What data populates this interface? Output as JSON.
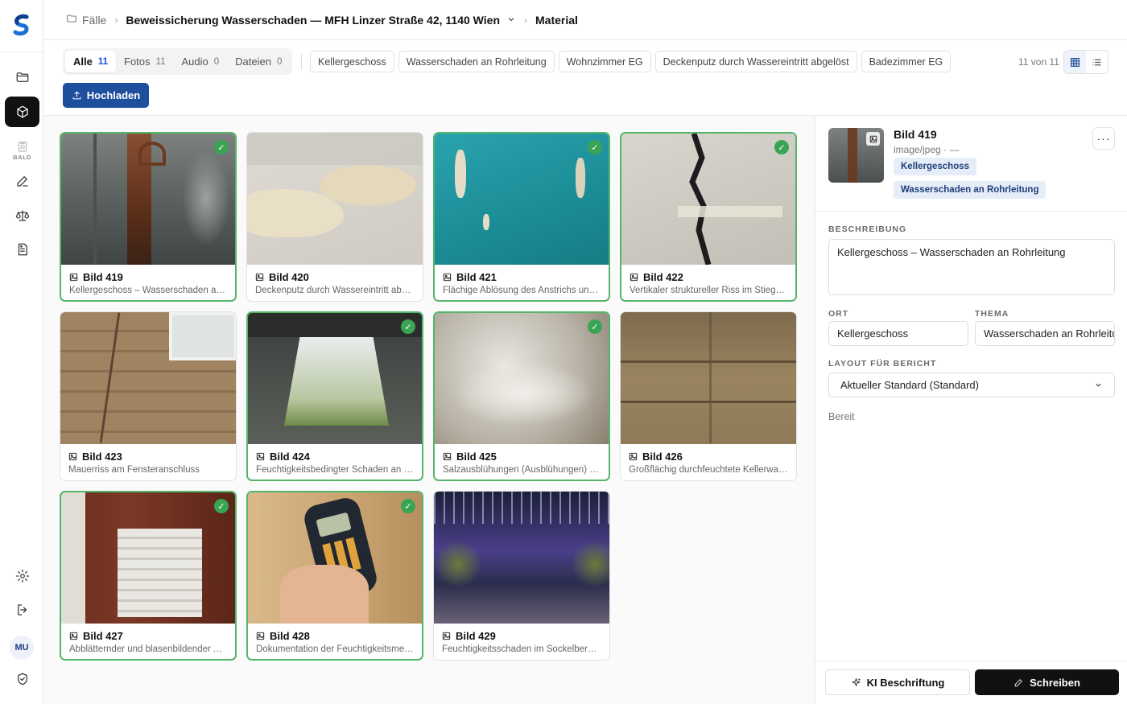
{
  "brand": {
    "accent": "#1e4f9c",
    "selected_border": "#55b56a",
    "check": "#3aa455"
  },
  "rail": {
    "soon_label": "BALD",
    "avatar": "MU"
  },
  "breadcrumb": {
    "root": "Fälle",
    "case": "Beweissicherung Wasserschaden — MFH Linzer Straße 42, 1140 Wien",
    "current": "Material"
  },
  "tabs": [
    {
      "label": "Alle",
      "count": "11"
    },
    {
      "label": "Fotos",
      "count": "11"
    },
    {
      "label": "Audio",
      "count": "0"
    },
    {
      "label": "Dateien",
      "count": "0"
    }
  ],
  "filters": [
    "Kellergeschoss",
    "Wasserschaden an Rohrleitung",
    "Wohnzimmer EG",
    "Deckenputz durch Wassereintritt abgelöst",
    "Badezimmer EG"
  ],
  "result_count": "11 von 11",
  "upload_label": "Hochladen",
  "items": [
    {
      "title": "Bild 419",
      "desc": "Kellergeschoss – Wasserschaden an Rohrleitung",
      "selected": true
    },
    {
      "title": "Bild 420",
      "desc": "Deckenputz durch Wassereintritt abgelöst",
      "selected": false
    },
    {
      "title": "Bild 421",
      "desc": "Flächige Ablösung des Anstrichs und b…",
      "selected": true
    },
    {
      "title": "Bild 422",
      "desc": "Vertikaler struktureller Riss im Stiegenh…",
      "selected": true
    },
    {
      "title": "Bild 423",
      "desc": "Mauerriss am Fensteranschluss",
      "selected": false
    },
    {
      "title": "Bild 424",
      "desc": "Feuchtigkeitsbedingter Schaden an der …",
      "selected": true
    },
    {
      "title": "Bild 425",
      "desc": "Salzausblühungen (Ausblühungen) an d…",
      "selected": true
    },
    {
      "title": "Bild 426",
      "desc": "Großflächig durchfeuchtete Kellerwand…",
      "selected": false
    },
    {
      "title": "Bild 427",
      "desc": "Abblätternder und blasenbildender Anst…",
      "selected": true
    },
    {
      "title": "Bild 428",
      "desc": "Dokumentation der Feuchtigkeitsmessu…",
      "selected": true
    },
    {
      "title": "Bild 429",
      "desc": "Feuchtigkeitsschaden im Sockelbereic…",
      "selected": false
    }
  ],
  "detail": {
    "title": "Bild 419",
    "mime": "image/jpeg · —",
    "tags": [
      "Kellergeschoss",
      "Wasserschaden an Rohrleitung"
    ],
    "description_label": "BESCHREIBUNG",
    "description": "Kellergeschoss – Wasserschaden an Rohrleitung",
    "ort_label": "ORT",
    "ort": "Kellergeschoss",
    "thema_label": "THEMA",
    "thema": "Wasserschaden an Rohrleitung",
    "layout_label": "LAYOUT FÜR BERICHT",
    "layout_value": "Aktueller Standard (Standard)",
    "status": "Bereit",
    "ki_label": "KI Beschriftung",
    "write_label": "Schreiben"
  }
}
